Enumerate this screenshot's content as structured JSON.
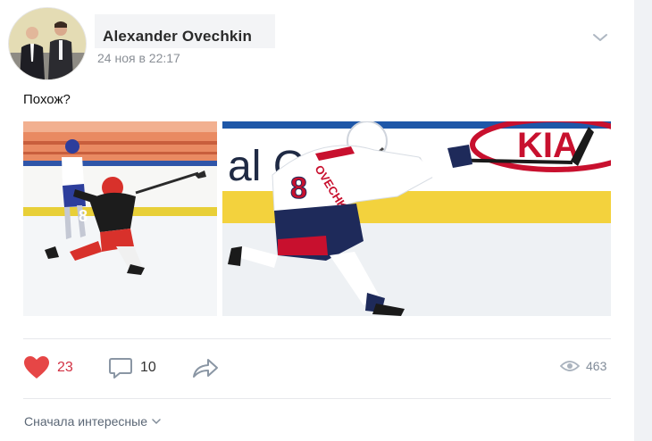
{
  "post": {
    "author_name": "Alexander Ovechkin",
    "date": "24 ноя в 22:17",
    "text": "Похож?"
  },
  "photos": [
    {
      "id": "photo-1",
      "jersey_number": "8"
    },
    {
      "id": "photo-2",
      "jersey_name": "OVECHKIN",
      "jersey_number": "8",
      "board_text_left": "al C",
      "board_text_right": "KIA"
    }
  ],
  "actions": {
    "likes": "23",
    "comments": "10",
    "views": "463"
  },
  "comments_sort": {
    "label": "Сначала интересные"
  },
  "colors": {
    "like_red": "#e64646",
    "muted": "#818c99",
    "rink_yellow": "#f3d23d",
    "capitals_red": "#c8102e",
    "capitals_navy": "#1e2a5a"
  },
  "icons": [
    "menu-chevron-icon",
    "heart-icon",
    "comment-icon",
    "share-icon",
    "eye-icon",
    "chevron-down-icon"
  ]
}
